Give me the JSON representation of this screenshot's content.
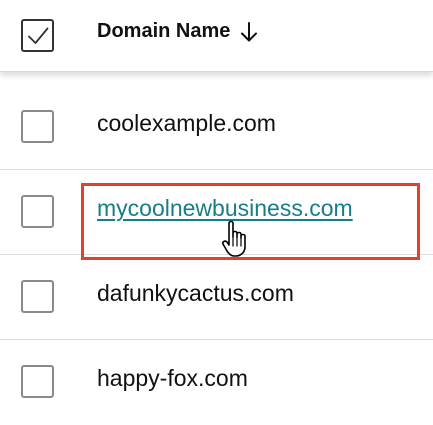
{
  "table": {
    "header": {
      "select_all_checked": true,
      "column_label": "Domain Name",
      "sort_direction": "descending"
    },
    "rows": [
      {
        "domain": "coolexample.com",
        "checked": false,
        "highlighted": false
      },
      {
        "domain": "mycoolnewbusiness.com",
        "checked": false,
        "highlighted": true
      },
      {
        "domain": "dafunkycactus.com",
        "checked": false,
        "highlighted": false
      },
      {
        "domain": "happy-fox.com",
        "checked": false,
        "highlighted": false
      }
    ]
  },
  "colors": {
    "link": "#177e89",
    "highlight_border": "#e4402e",
    "checkbox_border": "#8a8a8a",
    "text": "#111111"
  },
  "icons": {
    "select_all": "checkmark-icon",
    "sort": "arrow-down-icon",
    "cursor": "hand-pointer-icon"
  }
}
